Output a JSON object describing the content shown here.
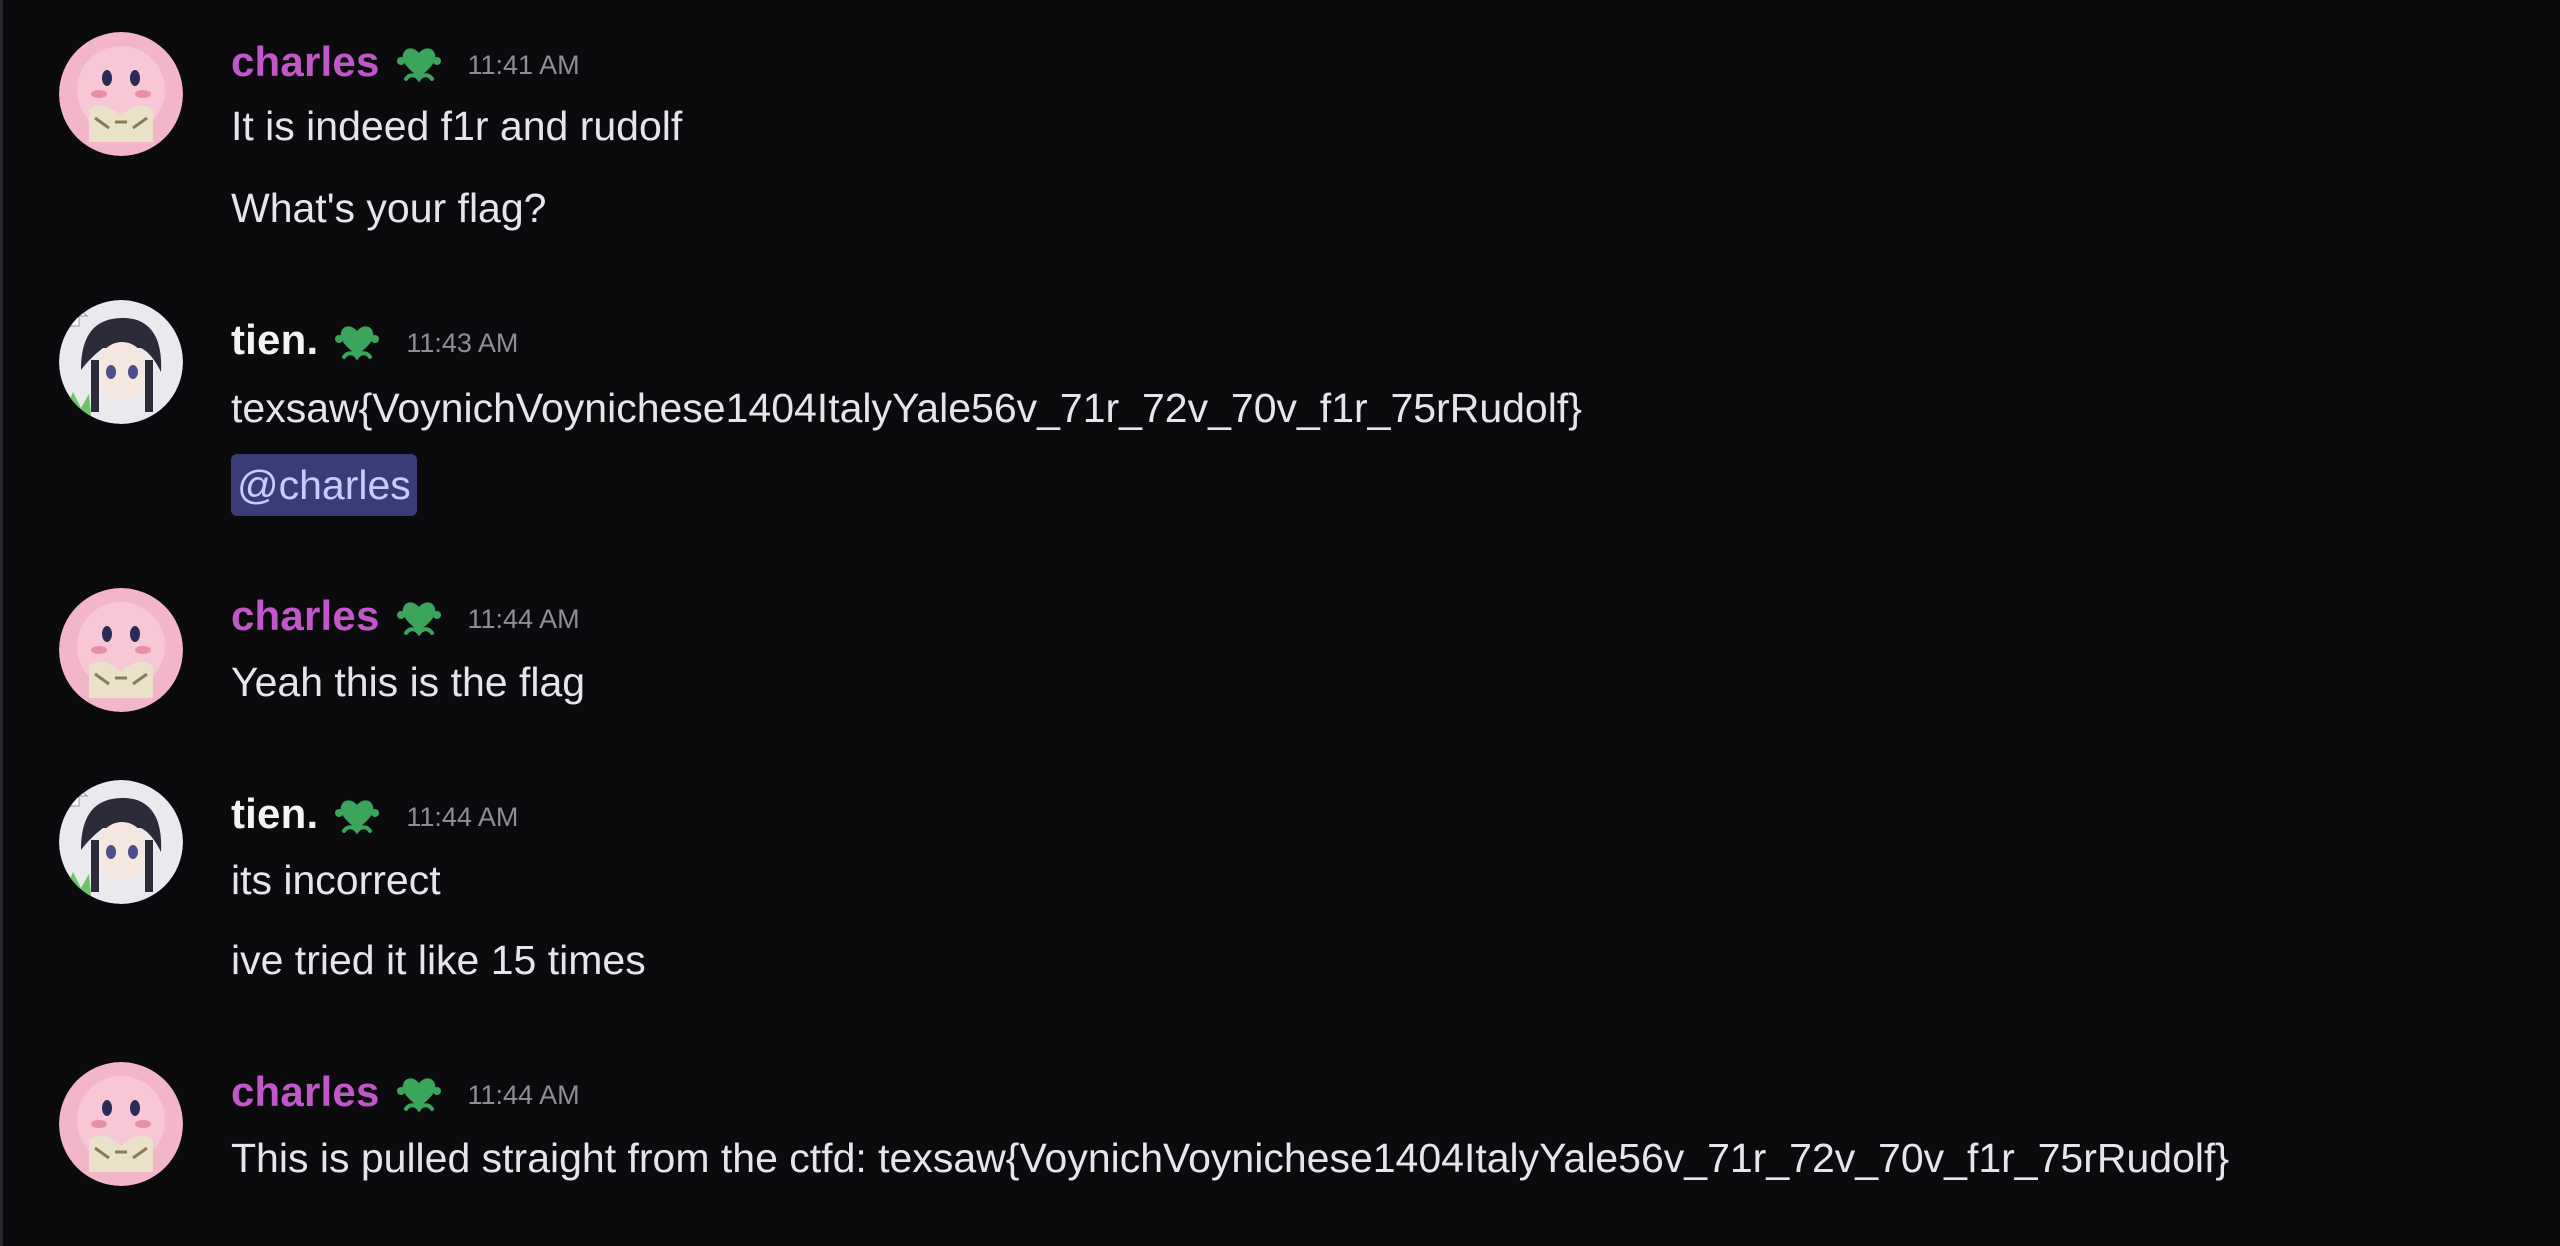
{
  "messages": [
    {
      "author": "charles",
      "time": "11:41 AM",
      "lines": [
        "It is indeed f1r and rudolf",
        "What's your flag?"
      ]
    },
    {
      "author": "tien.",
      "time": "11:43 AM",
      "lines": [
        "texsaw{VoynichVoynichese1404ItalyYale56v_71r_72v_70v_f1r_75rRudolf}"
      ],
      "mention": "@charles"
    },
    {
      "author": "charles",
      "time": "11:44 AM",
      "lines": [
        "Yeah this is the flag"
      ]
    },
    {
      "author": "tien.",
      "time": "11:44 AM",
      "lines": [
        "its incorrect",
        "ive tried it like 15 times"
      ]
    },
    {
      "author": "charles",
      "time": "11:44 AM",
      "lines": [
        "This is pulled straight from the ctfd: texsaw{VoynichVoynichese1404ItalyYale56v_71r_72v_70v_f1r_75rRudolf}"
      ]
    }
  ],
  "icons": {
    "badge": "green-heart-badge-icon",
    "charles_avatar": "pink-character-avatar",
    "tien_avatar": "anime-girl-avatar"
  },
  "colors": {
    "background": "#0b0b0d",
    "charles_name": "#c157c9",
    "tien_name": "#f2f3f5",
    "badge_green": "#3ba55c",
    "mention_bg": "#3a3c78",
    "mention_text": "#c7ccff",
    "timestamp": "#8d8f96"
  }
}
